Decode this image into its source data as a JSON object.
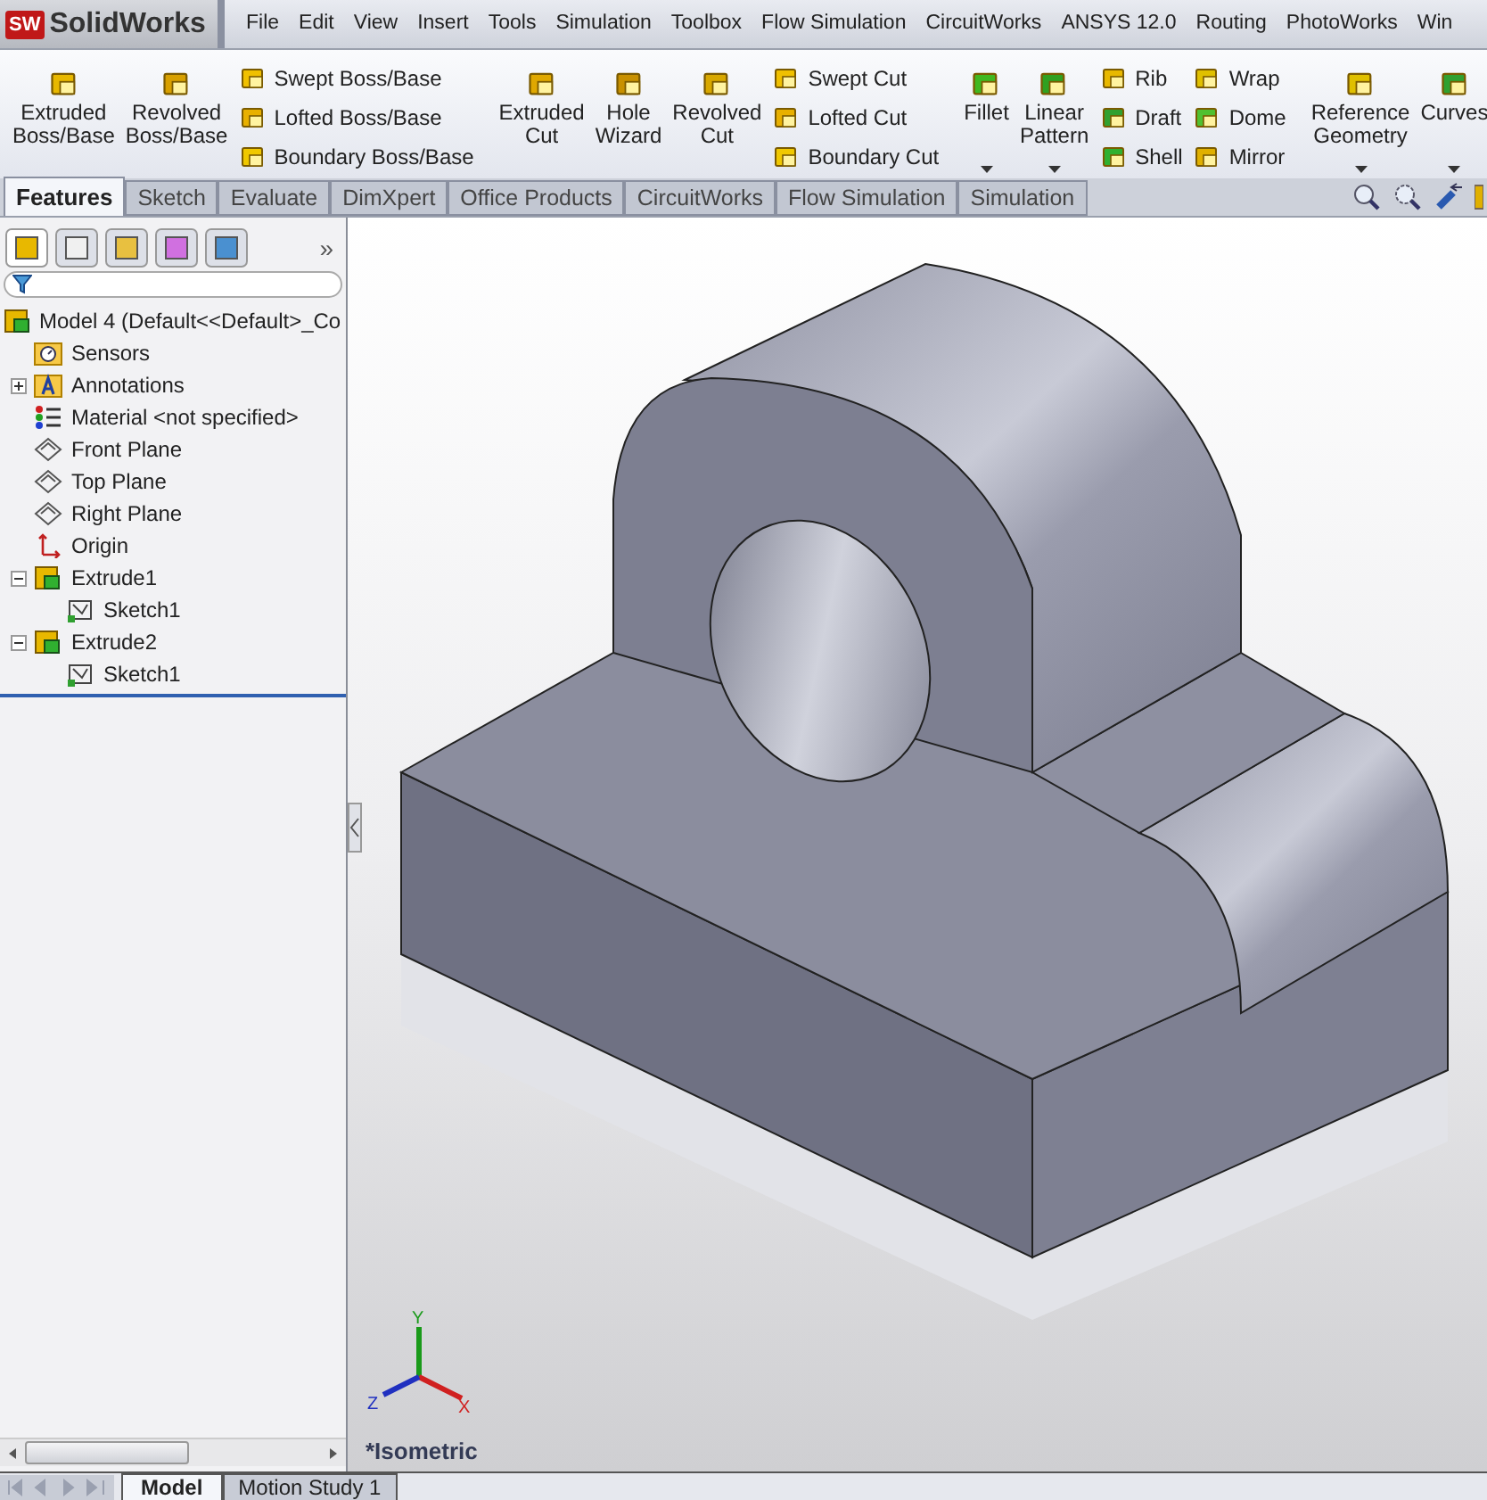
{
  "app": {
    "badge": "SW",
    "title": "SolidWorks"
  },
  "menu": [
    "File",
    "Edit",
    "View",
    "Insert",
    "Tools",
    "Simulation",
    "Toolbox",
    "Flow Simulation",
    "CircuitWorks",
    "ANSYS 12.0",
    "Routing",
    "PhotoWorks",
    "Win"
  ],
  "ribbon": [
    {
      "kind": "large",
      "label": "Extruded Boss/Base"
    },
    {
      "kind": "large",
      "label": "Revolved Boss/Base"
    },
    {
      "kind": "stack",
      "items": [
        {
          "label": "Swept Boss/Base"
        },
        {
          "label": "Lofted Boss/Base"
        },
        {
          "label": "Boundary Boss/Base"
        }
      ]
    },
    {
      "kind": "separator"
    },
    {
      "kind": "large",
      "label": "Extruded Cut"
    },
    {
      "kind": "large",
      "label": "Hole Wizard"
    },
    {
      "kind": "large",
      "label": "Revolved Cut"
    },
    {
      "kind": "stack",
      "items": [
        {
          "label": "Swept Cut"
        },
        {
          "label": "Lofted Cut"
        },
        {
          "label": "Boundary Cut"
        }
      ]
    },
    {
      "kind": "separator"
    },
    {
      "kind": "large",
      "label": "Fillet",
      "dropdown": true
    },
    {
      "kind": "large",
      "label": "Linear Pattern",
      "dropdown": true
    },
    {
      "kind": "stack",
      "items": [
        {
          "label": "Rib"
        },
        {
          "label": "Draft"
        },
        {
          "label": "Shell"
        }
      ]
    },
    {
      "kind": "stack",
      "items": [
        {
          "label": "Wrap"
        },
        {
          "label": "Dome"
        },
        {
          "label": "Mirror"
        }
      ]
    },
    {
      "kind": "separator"
    },
    {
      "kind": "large",
      "label": "Reference Geometry",
      "dropdown": true
    },
    {
      "kind": "large",
      "label": "Curves",
      "dropdown": true
    }
  ],
  "command_tabs": [
    {
      "label": "Features",
      "selected": true
    },
    {
      "label": "Sketch",
      "selected": false
    },
    {
      "label": "Evaluate",
      "selected": false
    },
    {
      "label": "DimXpert",
      "selected": false
    },
    {
      "label": "Office Products",
      "selected": false
    },
    {
      "label": "CircuitWorks",
      "selected": false
    },
    {
      "label": "Flow Simulation",
      "selected": false
    },
    {
      "label": "Simulation",
      "selected": false
    }
  ],
  "panel": {
    "more": "»",
    "tree_root": "Model 4  (Default<<Default>_Co",
    "tree": [
      {
        "label": "Sensors",
        "kind": "sensor"
      },
      {
        "label": "Annotations",
        "kind": "annotation",
        "expanded": false
      },
      {
        "label": "Material <not specified>",
        "kind": "material"
      },
      {
        "label": "Front Plane",
        "kind": "plane"
      },
      {
        "label": "Top Plane",
        "kind": "plane"
      },
      {
        "label": "Right Plane",
        "kind": "plane"
      },
      {
        "label": "Origin",
        "kind": "origin"
      },
      {
        "label": "Extrude1",
        "kind": "feature",
        "expanded": true,
        "children": [
          {
            "label": "Sketch1",
            "kind": "sketch"
          }
        ]
      },
      {
        "label": "Extrude2",
        "kind": "feature",
        "expanded": true,
        "children": [
          {
            "label": "Sketch1",
            "kind": "sketch"
          }
        ]
      }
    ]
  },
  "viewport": {
    "view_name": "*Isometric",
    "axes": {
      "x": "X",
      "y": "Y",
      "z": "Z"
    }
  },
  "bottom_tabs": [
    {
      "label": "Model",
      "selected": true
    },
    {
      "label": "Motion Study 1",
      "selected": false
    }
  ]
}
